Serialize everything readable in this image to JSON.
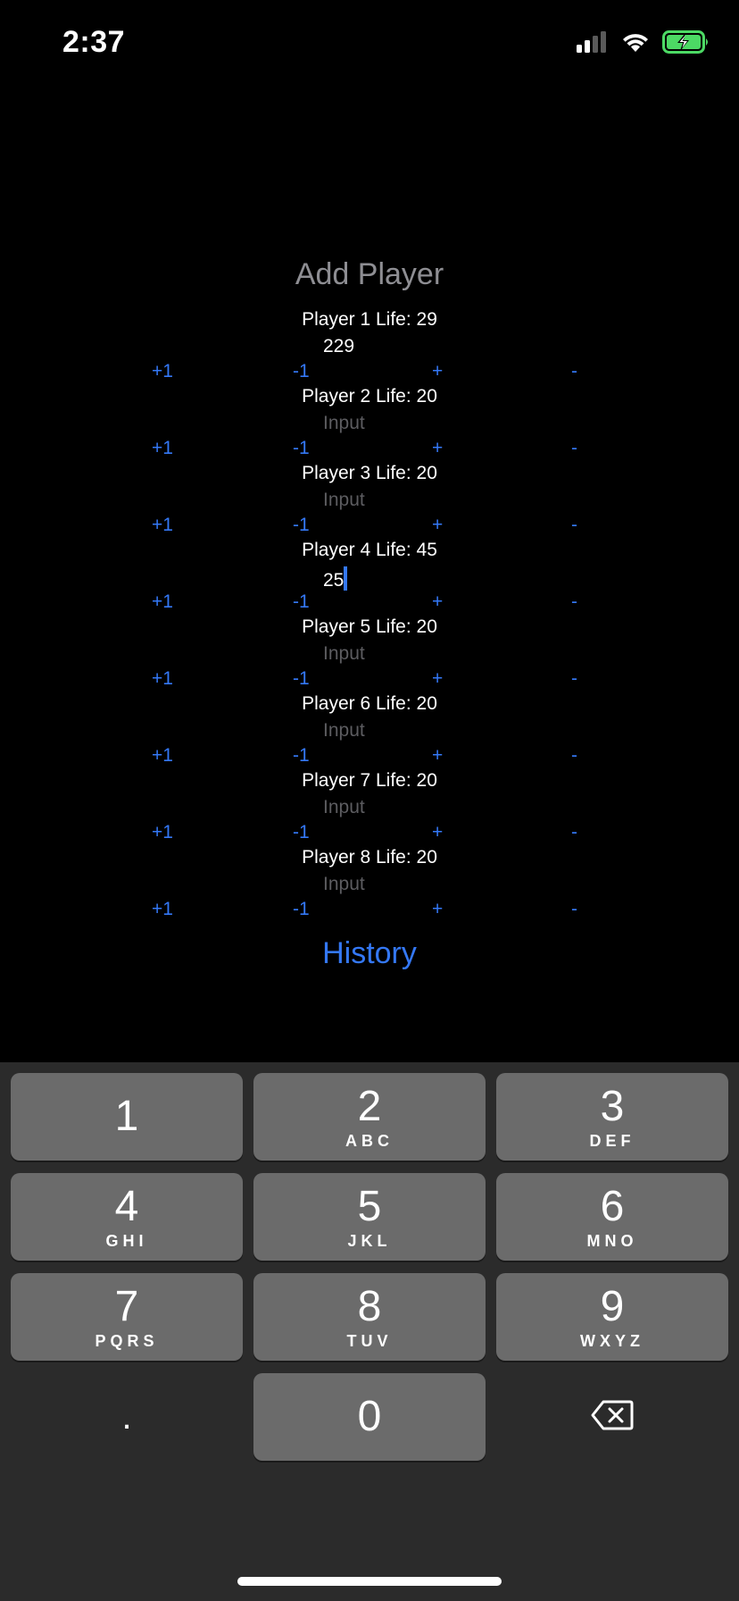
{
  "status_bar": {
    "time": "2:37",
    "signal_icon": "cellular-signal-icon",
    "wifi_icon": "wifi-icon",
    "battery_icon": "battery-charging-icon",
    "battery_color": "#4cd964"
  },
  "header": {
    "add_player_label": "Add Player"
  },
  "players": [
    {
      "life_label": "Player 1 Life: 29",
      "input_value": "229",
      "input_placeholder": "Input"
    },
    {
      "life_label": "Player 2 Life: 20",
      "input_value": "",
      "input_placeholder": "Input"
    },
    {
      "life_label": "Player 3 Life: 20",
      "input_value": "",
      "input_placeholder": "Input"
    },
    {
      "life_label": "Player 4 Life: 45",
      "input_value": "25",
      "input_placeholder": "Input",
      "focused": true
    },
    {
      "life_label": "Player 5 Life: 20",
      "input_value": "",
      "input_placeholder": "Input"
    },
    {
      "life_label": "Player 6 Life: 20",
      "input_value": "",
      "input_placeholder": "Input"
    },
    {
      "life_label": "Player 7 Life: 20",
      "input_value": "",
      "input_placeholder": "Input"
    },
    {
      "life_label": "Player 8 Life: 20",
      "input_value": "",
      "input_placeholder": "Input"
    }
  ],
  "buttons": {
    "plus_one": "+1",
    "minus_one": "-1",
    "plus": "+",
    "minus": "-"
  },
  "history_label": "History",
  "keyboard": {
    "keys": [
      {
        "digit": "1",
        "letters": ""
      },
      {
        "digit": "2",
        "letters": "ABC"
      },
      {
        "digit": "3",
        "letters": "DEF"
      },
      {
        "digit": "4",
        "letters": "GHI"
      },
      {
        "digit": "5",
        "letters": "JKL"
      },
      {
        "digit": "6",
        "letters": "MNO"
      },
      {
        "digit": "7",
        "letters": "PQRS"
      },
      {
        "digit": "8",
        "letters": "TUV"
      },
      {
        "digit": "9",
        "letters": "WXYZ"
      },
      {
        "digit": "0",
        "letters": ""
      }
    ],
    "dot_label": ".",
    "delete_icon": "backspace-icon"
  },
  "colors": {
    "accent": "#3478f6",
    "background": "#000000",
    "placeholder": "#5c5c60",
    "keyboard_bg": "#2b2b2b",
    "key_bg": "#6b6b6b"
  }
}
